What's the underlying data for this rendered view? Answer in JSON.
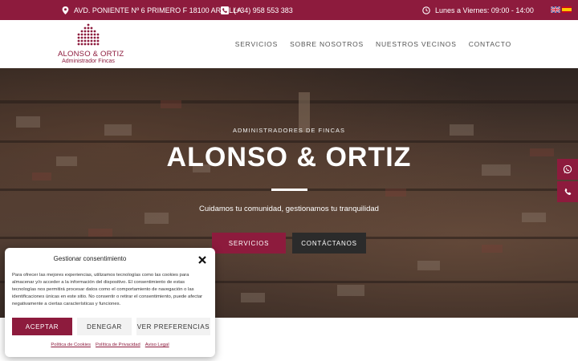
{
  "topbar": {
    "address": "AVD. PONIENTE Nº 6 PRIMERO F 18100 ARMILLA",
    "phone": "(+34) 958 553 383",
    "hours": "Lunes a Viernes: 09:00 - 14:00",
    "icons": {
      "address": "map-pin-icon",
      "phone": "phone-icon",
      "hours": "clock-icon"
    },
    "flags": [
      "english-flag-icon",
      "spanish-flag-icon"
    ]
  },
  "logo": {
    "name": "ALONSO & ORTIZ",
    "subtitle": "Administrador Fincas"
  },
  "nav": {
    "items": [
      "SERVICIOS",
      "SOBRE NOSOTROS",
      "NUESTROS VECINOS",
      "CONTACTO"
    ]
  },
  "hero": {
    "eyebrow": "ADMINISTRADORES DE FINCAS",
    "title": "ALONSO & ORTIZ",
    "tagline": "Cuidamos tu comunidad, gestionamos tu tranquilidad",
    "primary_button": "SERVICIOS",
    "secondary_button": "CONTÁCTANOS"
  },
  "side_buttons": [
    "whatsapp-icon",
    "phone-icon"
  ],
  "cookie": {
    "title": "Gestionar consentimiento",
    "body": "Para ofrecer las mejores experiencias, utilizamos tecnologías como las cookies para almacenar y/o acceder a la información del dispositivo. El consentimiento de estas tecnologías nos permitirá procesar datos como el comportamiento de navegación o las identificaciones únicas en este sitio. No consentir o retirar el consentimiento, puede afectar negativamente a ciertas características y funciones.",
    "accept": "ACEPTAR",
    "deny": "DENEGAR",
    "preferences": "VER PREFERENCIAS",
    "links": [
      "Política de Cookies",
      "Política de Privacidad",
      "Aviso Legal"
    ]
  },
  "colors": {
    "brand": "#8d1b3d",
    "dark_button": "#2b2b2b"
  }
}
